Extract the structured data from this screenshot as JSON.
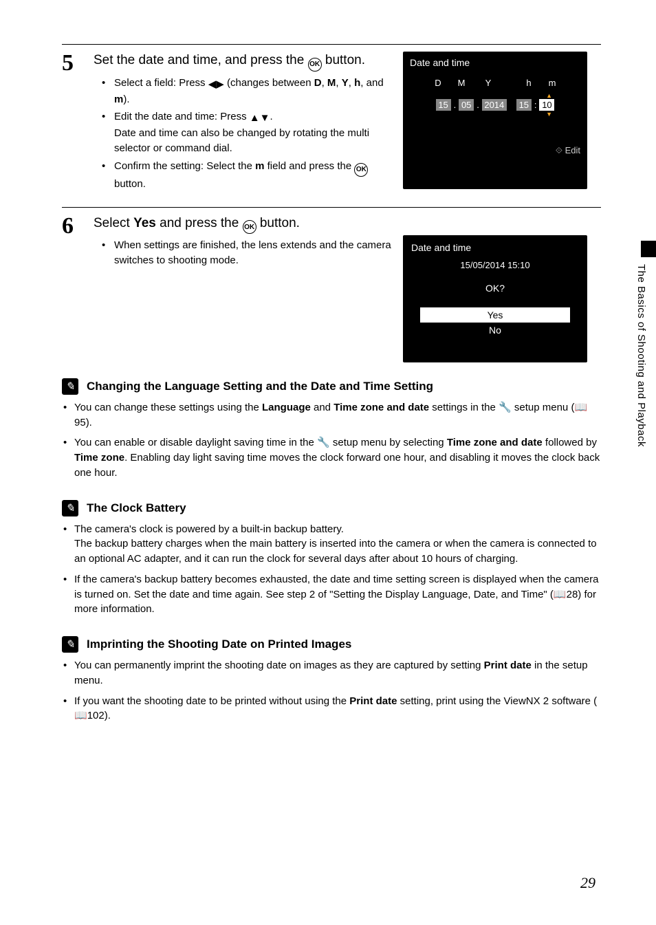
{
  "sideTab": "The Basics of Shooting and Playback",
  "pageNumber": "29",
  "step5": {
    "num": "5",
    "title_a": "Set the date and time, and press the ",
    "title_b": " button.",
    "b1_a": "Select a field: Press ",
    "b1_b": " (changes between ",
    "b1_fields": [
      "D",
      "M",
      "Y",
      "h",
      "m"
    ],
    "b1_c": ").",
    "b2_a": "Edit the date and time: Press ",
    "b2_b": ".\nDate and time can also be changed by rotating the multi selector or command dial.",
    "b3_a": "Confirm the setting: Select the ",
    "b3_field": "m",
    "b3_b": " field and press the ",
    "b3_c": " button."
  },
  "screen1": {
    "title": "Date and time",
    "labels": [
      "D",
      "M",
      "Y",
      "h",
      "m"
    ],
    "vals": [
      "15",
      "05",
      "2014",
      "15",
      "10"
    ],
    "edit": "Edit"
  },
  "step6": {
    "num": "6",
    "title_a": "Select ",
    "title_yes": "Yes",
    "title_b": " and press the ",
    "title_c": " button.",
    "b1": "When settings are finished, the lens extends and the camera switches to shooting mode."
  },
  "screen2": {
    "title": "Date and time",
    "dt": "15/05/2014  15:10",
    "okq": "OK?",
    "yes": "Yes",
    "no": "No"
  },
  "note1": {
    "title": "Changing the Language Setting and the Date and Time Setting",
    "b1_a": "You can change these settings using the ",
    "b1_lang": "Language",
    "b1_b": " and ",
    "b1_tz": "Time zone and date",
    "b1_c": " settings in the ",
    "b1_d": " setup menu (",
    "b1_ref": "95",
    "b1_e": ").",
    "b2_a": "You can enable or disable daylight saving time in the ",
    "b2_b": " setup menu by selecting ",
    "b2_tz": "Time zone and date",
    "b2_c": " followed by ",
    "b2_tz2": "Time zone",
    "b2_d": ". Enabling day light saving time moves the clock forward one hour, and disabling it moves the clock back one hour."
  },
  "note2": {
    "title": "The Clock Battery",
    "b1": "The camera's clock is powered by a built-in backup battery.\nThe backup battery charges when the main battery is inserted into the camera or when the camera is connected to an optional AC adapter, and it can run the clock for several days after about 10 hours of charging.",
    "b2_a": "If the camera's backup battery becomes exhausted, the date and time setting screen is displayed when the camera is turned on. Set the date and time again. See step 2 of \"Setting the Display Language, Date, and Time\" (",
    "b2_ref": "28",
    "b2_b": ") for more information."
  },
  "note3": {
    "title": "Imprinting the Shooting Date on Printed Images",
    "b1_a": "You can permanently imprint the shooting date on images as they are captured by setting ",
    "b1_pd": "Print date",
    "b1_b": " in the setup menu.",
    "b2_a": "If you want the shooting date to be printed without using the ",
    "b2_pd": "Print date",
    "b2_b": " setting, print using the ViewNX 2 software (",
    "b2_ref": "102",
    "b2_c": ")."
  }
}
